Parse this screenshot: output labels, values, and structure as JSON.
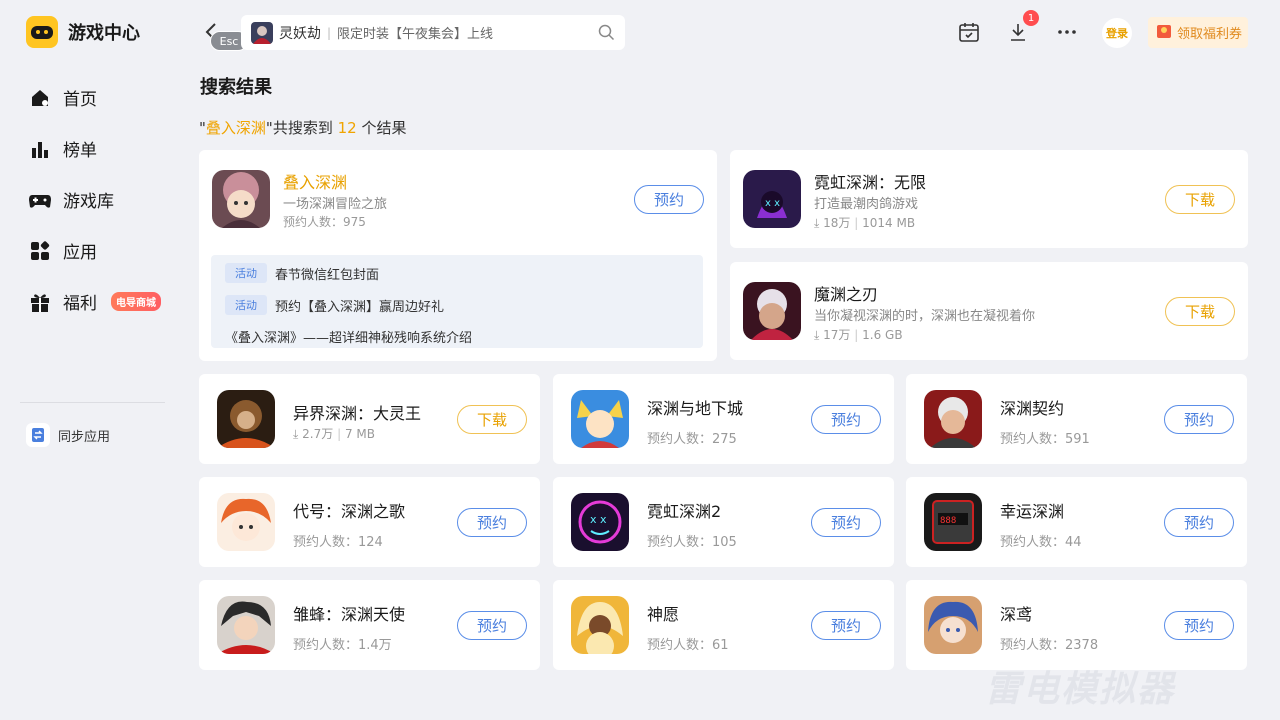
{
  "app": {
    "title": "游戏中心"
  },
  "sidebar": {
    "items": [
      {
        "label": "首页",
        "icon": "home-icon"
      },
      {
        "label": "榜单",
        "icon": "ranking-icon"
      },
      {
        "label": "游戏库",
        "icon": "gamepad-icon"
      },
      {
        "label": "应用",
        "icon": "apps-icon"
      },
      {
        "label": "福利",
        "icon": "gift-icon",
        "badge": "电导商城"
      }
    ],
    "sync_label": "同步应用"
  },
  "topbar": {
    "esc_label": "Esc",
    "search_game": "灵妖劫",
    "search_sub": "限定时装【午夜集会】上线",
    "download_badge": "1",
    "login_label": "登录",
    "coupon_label": "领取福利券"
  },
  "main": {
    "title": "搜索结果",
    "summary": {
      "quote_open": "\"",
      "keyword": "叠入深渊",
      "mid": "\"共搜索到 ",
      "count": "12",
      "tail": " 个结果"
    }
  },
  "featured": {
    "name": "叠入深渊",
    "desc": "一场深渊冒险之旅",
    "meta": "预约人数：975",
    "button": "预约",
    "activities": [
      {
        "tag": "活动",
        "text": "春节微信红包封面"
      },
      {
        "tag": "活动",
        "text": "预约【叠入深渊】赢周边好礼"
      },
      {
        "tag": "",
        "text": "《叠入深渊》——超详细神秘残响系统介绍"
      }
    ]
  },
  "side_cards": [
    {
      "name": "霓虹深渊：无限",
      "desc": "打造最潮肉鸽游戏",
      "downloads": "18万",
      "size": "1014 MB",
      "button": "下载"
    },
    {
      "name": "魔渊之刃",
      "desc": "当你凝视深渊的时，深渊也在凝视着你",
      "downloads": "17万",
      "size": "1.6 GB",
      "button": "下载"
    }
  ],
  "grid": [
    {
      "name": "异界深渊：大灵王",
      "downloads": "2.7万",
      "size": "7 MB",
      "meta": "",
      "button": "下载",
      "type": "dl"
    },
    {
      "name": "深渊与地下城",
      "meta": "预约人数：275",
      "button": "预约",
      "type": "book"
    },
    {
      "name": "深渊契约",
      "meta": "预约人数：591",
      "button": "预约",
      "type": "book"
    },
    {
      "name": "代号：深渊之歌",
      "meta": "预约人数：124",
      "button": "预约",
      "type": "book"
    },
    {
      "name": "霓虹深渊2",
      "meta": "预约人数：105",
      "button": "预约",
      "type": "book"
    },
    {
      "name": "幸运深渊",
      "meta": "预约人数：44",
      "button": "预约",
      "type": "book"
    },
    {
      "name": "雏蜂：深渊天使",
      "meta": "预约人数：1.4万",
      "button": "预约",
      "type": "book"
    },
    {
      "name": "神愿",
      "meta": "预约人数：61",
      "button": "预约",
      "type": "book"
    },
    {
      "name": "深鸢",
      "meta": "预约人数：2378",
      "button": "预约",
      "type": "book"
    }
  ],
  "watermark": "雷电模拟器",
  "colors": {
    "accent": "#f0a400",
    "primary_blue": "#4a7fde",
    "background": "#f0f1f5"
  }
}
